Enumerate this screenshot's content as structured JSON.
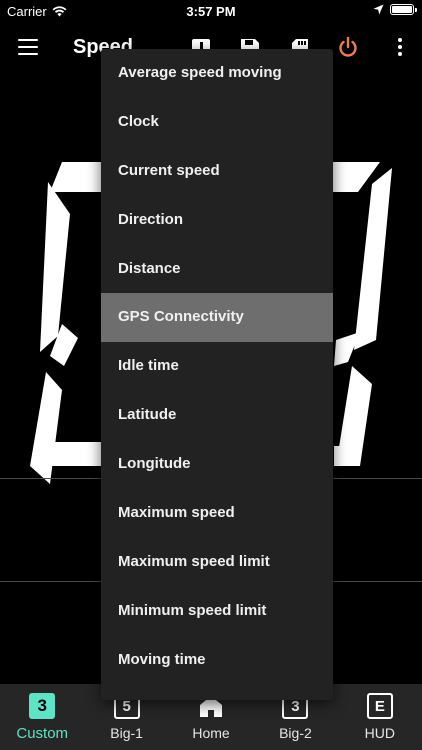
{
  "status_bar": {
    "carrier": "Carrier",
    "time": "3:57 PM"
  },
  "app_bar": {
    "title": "Speed"
  },
  "colors": {
    "accent": "#5de3c6",
    "power": "#f07d4c",
    "menu_bg": "#222222",
    "menu_selected": "#6e6e6e"
  },
  "dropdown": {
    "selected": "GPS Connectivity",
    "items": [
      "Average speed moving",
      "Clock",
      "Current speed",
      "Direction",
      "Distance",
      "GPS Connectivity",
      "Idle time",
      "Latitude",
      "Longitude",
      "Maximum speed",
      "Maximum speed limit",
      "Minimum speed limit",
      "Moving time"
    ]
  },
  "bottom_nav": [
    {
      "label": "Custom",
      "badge": "3",
      "active": true
    },
    {
      "label": "Big-1",
      "badge": "5",
      "active": false
    },
    {
      "label": "Home",
      "badge": "",
      "active": false
    },
    {
      "label": "Big-2",
      "badge": "3",
      "active": false
    },
    {
      "label": "HUD",
      "badge": "E",
      "active": false
    }
  ]
}
